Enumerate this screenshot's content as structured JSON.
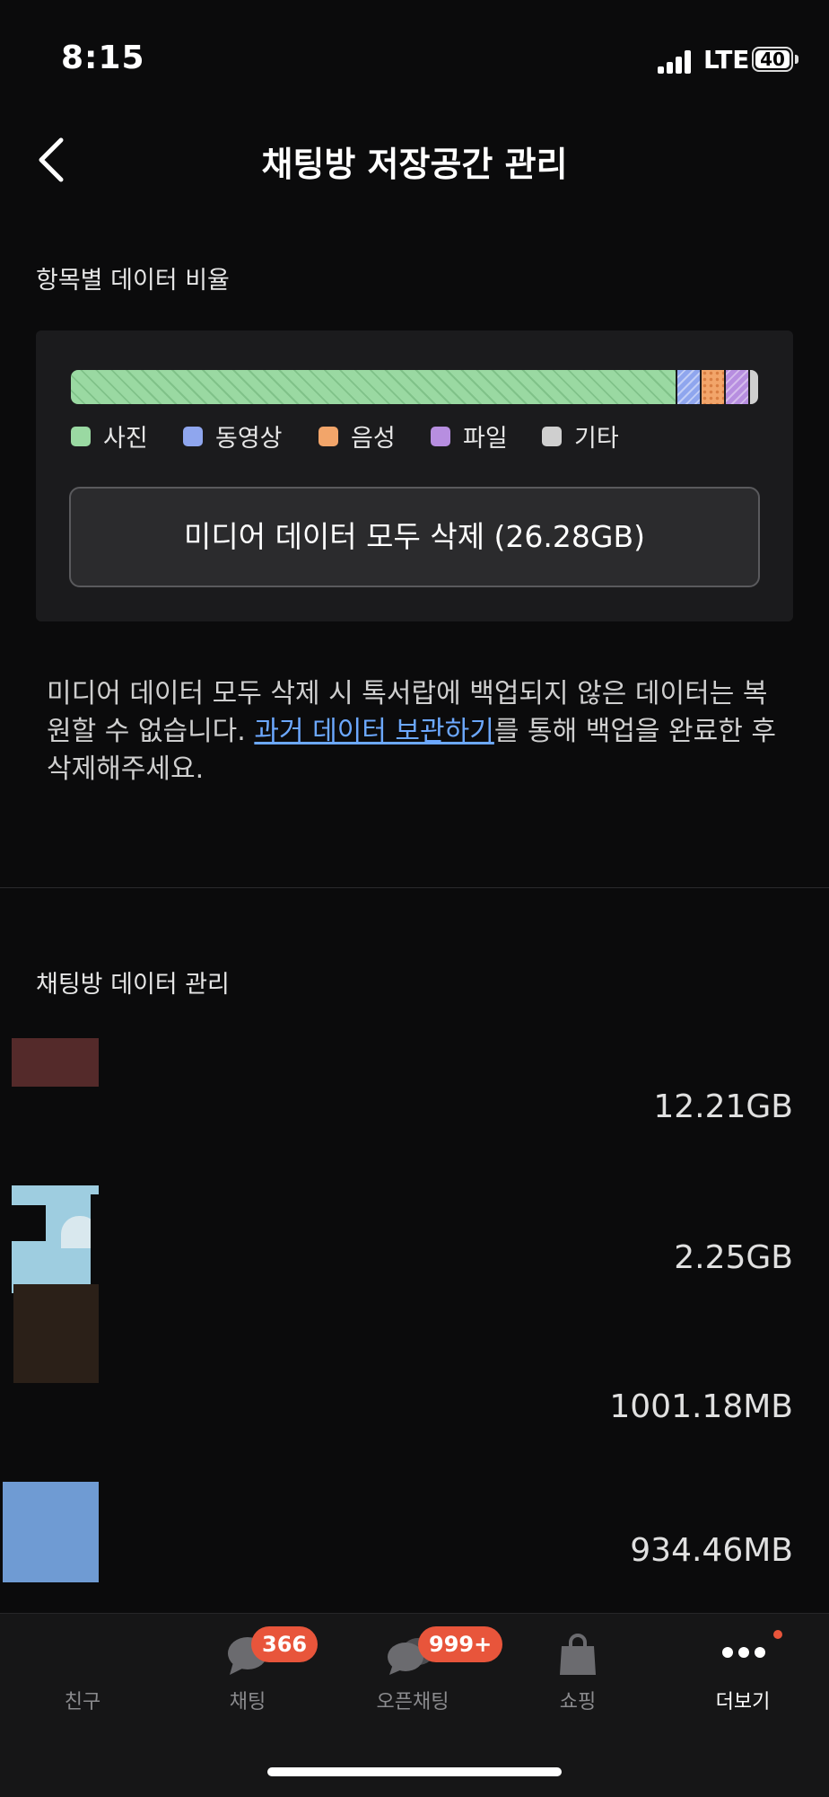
{
  "status_bar": {
    "time": "8:15",
    "network": "LTE",
    "battery": "40"
  },
  "header": {
    "title": "채팅방 저장공간 관리"
  },
  "ratio_section": {
    "label": "항목별 데이터 비율",
    "bar": [
      {
        "name": "사진",
        "fraction": 0.88,
        "color": "#9ad9a2"
      },
      {
        "name": "동영상",
        "fraction": 0.033,
        "color": "#8fa6ee"
      },
      {
        "name": "음성",
        "fraction": 0.033,
        "color": "#f2a56a"
      },
      {
        "name": "파일",
        "fraction": 0.033,
        "color": "#b78ee0"
      },
      {
        "name": "기타",
        "fraction": 0.021,
        "color": "#cfcfcf"
      }
    ],
    "legend": [
      "사진",
      "동영상",
      "음성",
      "파일",
      "기타"
    ],
    "delete_button": "미디어 데이터 모두 삭제 (26.28GB)"
  },
  "notice": {
    "before": "미디어 데이터 모두 삭제 시 톡서랍에 백업되지 않은 데이터는 복원할 수 없습니다. ",
    "link": "과거 데이터 보관하기",
    "after": "를 통해 백업을 완료한 후 삭제해주세요."
  },
  "chatrooms_section": {
    "label": "채팅방 데이터 관리",
    "rows": [
      {
        "size": "12.21GB"
      },
      {
        "size": "2.25GB"
      },
      {
        "size": "1001.18MB"
      },
      {
        "size": "934.46MB"
      }
    ]
  },
  "tabbar": {
    "items": [
      {
        "label": "친구"
      },
      {
        "label": "채팅",
        "badge": "366"
      },
      {
        "label": "오픈채팅",
        "badge": "999+"
      },
      {
        "label": "쇼핑"
      },
      {
        "label": "더보기"
      }
    ]
  }
}
